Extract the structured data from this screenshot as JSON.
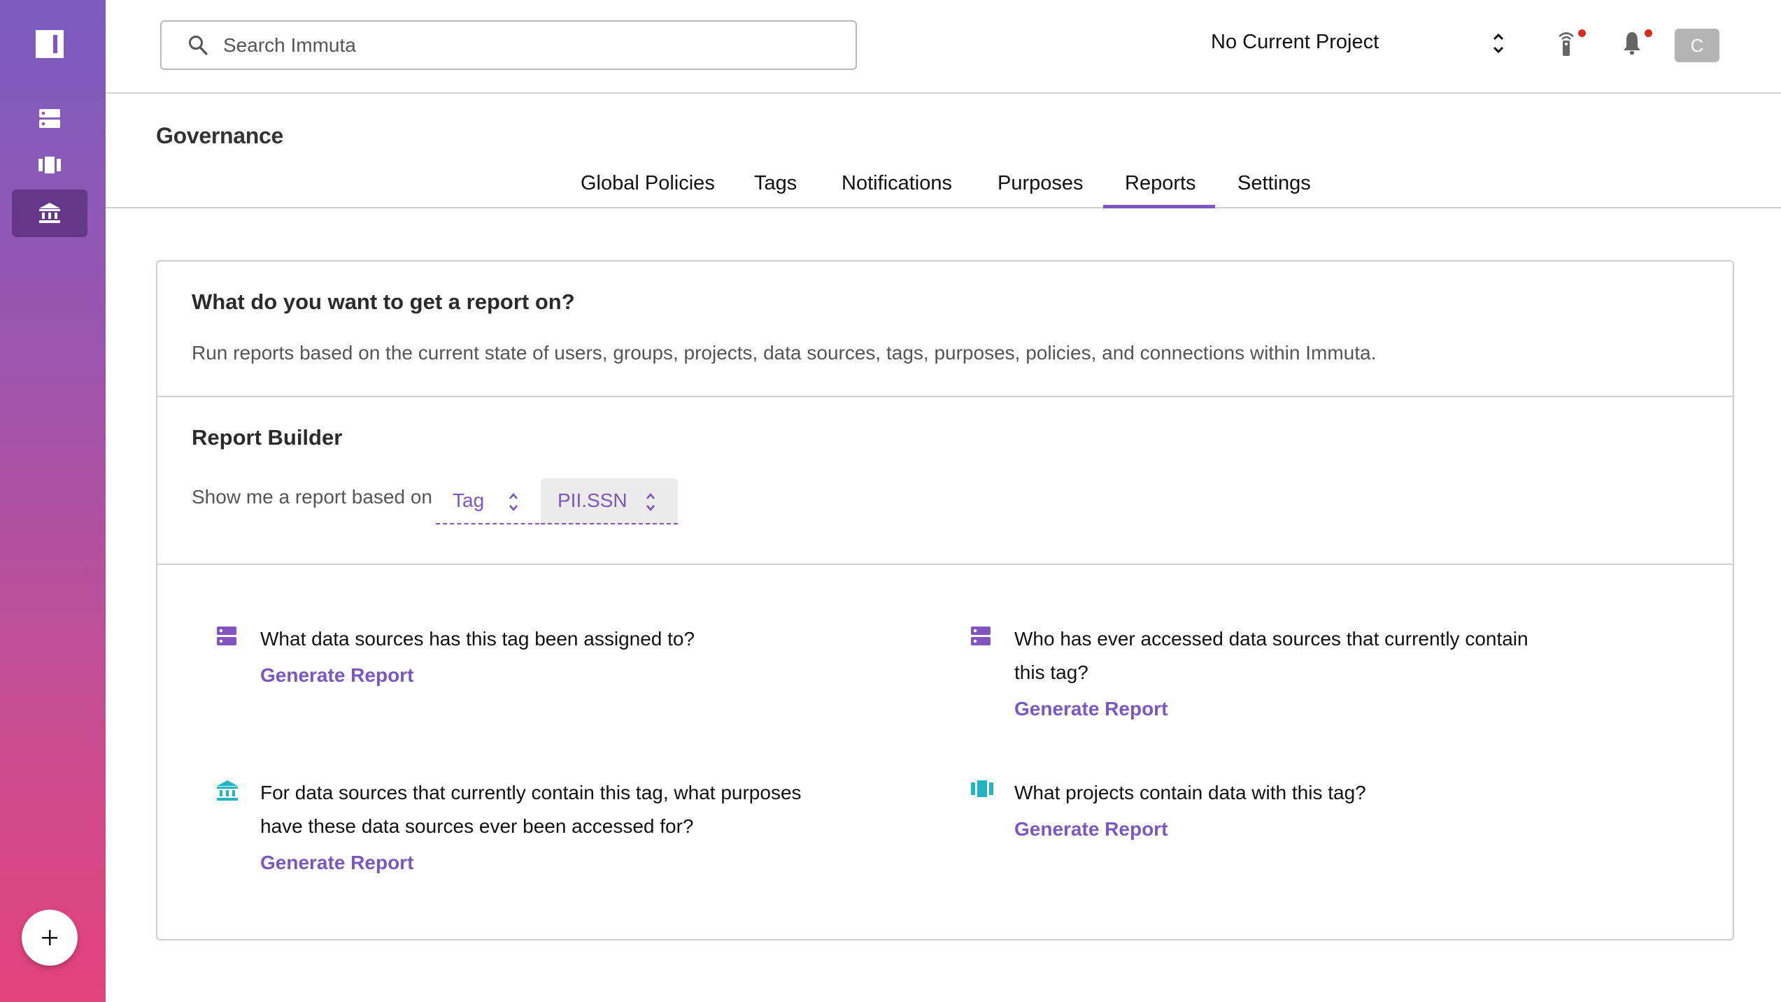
{
  "sidebar": {
    "items": [
      {
        "name": "data-sources",
        "icon": "data-sources-icon"
      },
      {
        "name": "projects",
        "icon": "projects-icon"
      },
      {
        "name": "governance",
        "icon": "governance-icon",
        "active": true
      }
    ],
    "fab_icon": "plus-icon"
  },
  "header": {
    "search_placeholder": "Search Immuta",
    "project_label": "No Current Project",
    "avatar_initial": "C",
    "notification_dot_color": "#d72d1e"
  },
  "page": {
    "title": "Governance",
    "tabs": [
      {
        "label": "Global Policies"
      },
      {
        "label": "Tags"
      },
      {
        "label": "Notifications"
      },
      {
        "label": "Purposes"
      },
      {
        "label": "Reports",
        "active": true
      },
      {
        "label": "Settings"
      }
    ]
  },
  "intro": {
    "title": "What do you want to get a report on?",
    "description": "Run reports based on the current state of users, groups, projects, data sources, tags, purposes, policies, and connections within Immuta."
  },
  "builder": {
    "title": "Report Builder",
    "label": "Show me a report based on",
    "entity_type": "Tag",
    "entity_value": "PII.SSN"
  },
  "reports": [
    {
      "question": "What data sources has this tag been assigned to?",
      "icon": "data-sources-icon",
      "action": "Generate Report"
    },
    {
      "question": "Who has ever accessed data sources that currently contain this tag?",
      "icon": "data-sources-icon",
      "action": "Generate Report"
    },
    {
      "question": "For data sources that currently contain this tag, what purposes have these data sources ever been accessed for?",
      "icon": "purposes-icon",
      "action": "Generate Report"
    },
    {
      "question": "What projects contain data with this tag?",
      "icon": "projects-icon",
      "action": "Generate Report"
    }
  ],
  "colors": {
    "accent": "#7a58bf",
    "teal": "#20b5c0",
    "sidebar_top": "#7b5cbf",
    "sidebar_bottom": "#e44379"
  }
}
